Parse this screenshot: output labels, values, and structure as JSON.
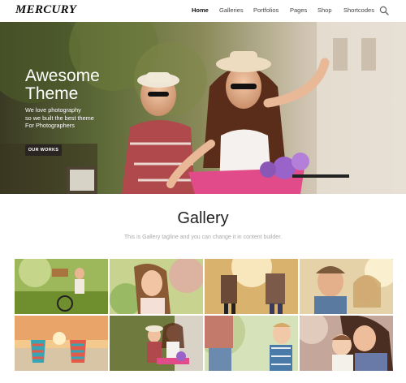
{
  "header": {
    "logo": "MERCURY",
    "nav": [
      {
        "label": "Home",
        "active": true
      },
      {
        "label": "Galleries",
        "active": false
      },
      {
        "label": "Portfolios",
        "active": false
      },
      {
        "label": "Pages",
        "active": false
      },
      {
        "label": "Shop",
        "active": false
      },
      {
        "label": "Shortcodes",
        "active": false
      }
    ],
    "search_icon": "search-icon"
  },
  "hero": {
    "title_line1": "Awesome",
    "title_line2": "Theme",
    "text_line1": "We love photography",
    "text_line2": "so we built the best theme",
    "text_line3": "For Photographers",
    "button_label": "OUR WORKS"
  },
  "gallery": {
    "title": "Gallery",
    "tagline": "This is Gallery tagline and you can change it in content builder.",
    "tiles": [
      {
        "name": "girl-on-bicycle-photo"
      },
      {
        "name": "woman-eating-ice-cream-photo"
      },
      {
        "name": "couple-holding-hands-photo"
      },
      {
        "name": "smiling-couple-photo"
      },
      {
        "name": "beach-chairs-photo"
      },
      {
        "name": "couple-with-bicycle-photo"
      },
      {
        "name": "father-and-son-photo"
      },
      {
        "name": "mother-and-child-photo"
      }
    ]
  },
  "colors": {
    "accent": "#2a2522",
    "text_dark": "#222222",
    "tagline": "#aaaaaa"
  }
}
